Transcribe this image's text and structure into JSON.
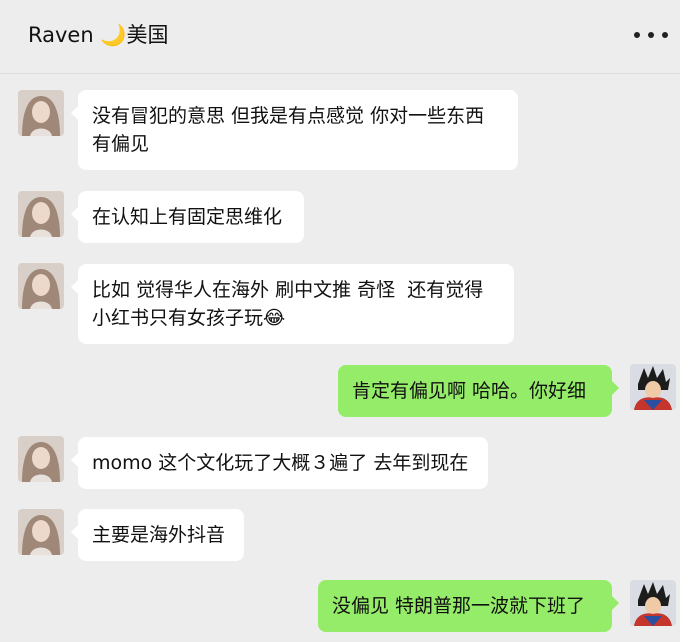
{
  "header": {
    "title": "Raven 🌙美国",
    "more_icon": "more-horizontal-icon"
  },
  "contacts": {
    "left_avatar_icon": "female-portrait-avatar",
    "right_avatar_icon": "anime-warrior-avatar",
    "colors": {
      "left_bubble": "#ffffff",
      "right_bubble": "#95ec69",
      "background": "#ededed"
    }
  },
  "messages": [
    {
      "side": "left",
      "text": "没有冒犯的意思 但我是有点感觉 你对一些东西\n有偏见"
    },
    {
      "side": "left",
      "text": "在认知上有固定思维化"
    },
    {
      "side": "left",
      "text": "比如 觉得华人在海外 刷中文推 奇怪  还有觉得\n小红书只有女孩子玩😂"
    },
    {
      "side": "right",
      "text": "肯定有偏见啊 哈哈。你好细"
    },
    {
      "side": "left",
      "text": "momo 这个文化玩了大概３遍了 去年到现在"
    },
    {
      "side": "left",
      "text": "主要是海外抖音"
    },
    {
      "side": "right",
      "text": "没偏见 特朗普那一波就下班了"
    }
  ]
}
